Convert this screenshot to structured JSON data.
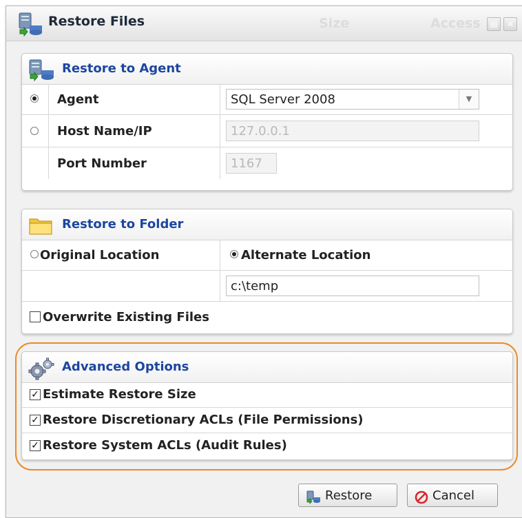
{
  "window": {
    "title": "Restore Files",
    "ghost_columns": [
      "Size",
      "Access"
    ]
  },
  "restore_to_agent": {
    "heading": "Restore to Agent",
    "agent_label": "Agent",
    "agent_value": "SQL Server 2008",
    "agent_selected": true,
    "host_label": "Host Name/IP",
    "host_value": "127.0.0.1",
    "port_label": "Port Number",
    "port_value": "1167"
  },
  "restore_to_folder": {
    "heading": "Restore to Folder",
    "original_label": "Original Location",
    "alternate_label": "Alternate Location",
    "alternate_selected": true,
    "path_value": "c:\\temp",
    "overwrite_label": "Overwrite Existing Files",
    "overwrite_checked": false
  },
  "advanced_options": {
    "heading": "Advanced Options",
    "options": [
      {
        "label": "Estimate Restore Size",
        "checked": true
      },
      {
        "label": "Restore Discretionary ACLs (File Permissions)",
        "checked": true
      },
      {
        "label": "Restore System ACLs (Audit Rules)",
        "checked": true
      }
    ],
    "highlight_color": "#ec8a27"
  },
  "buttons": {
    "restore_label": "Restore",
    "cancel_label": "Cancel"
  },
  "colors": {
    "heading_blue": "#1c46a0",
    "cancel_red": "#d8262b"
  }
}
